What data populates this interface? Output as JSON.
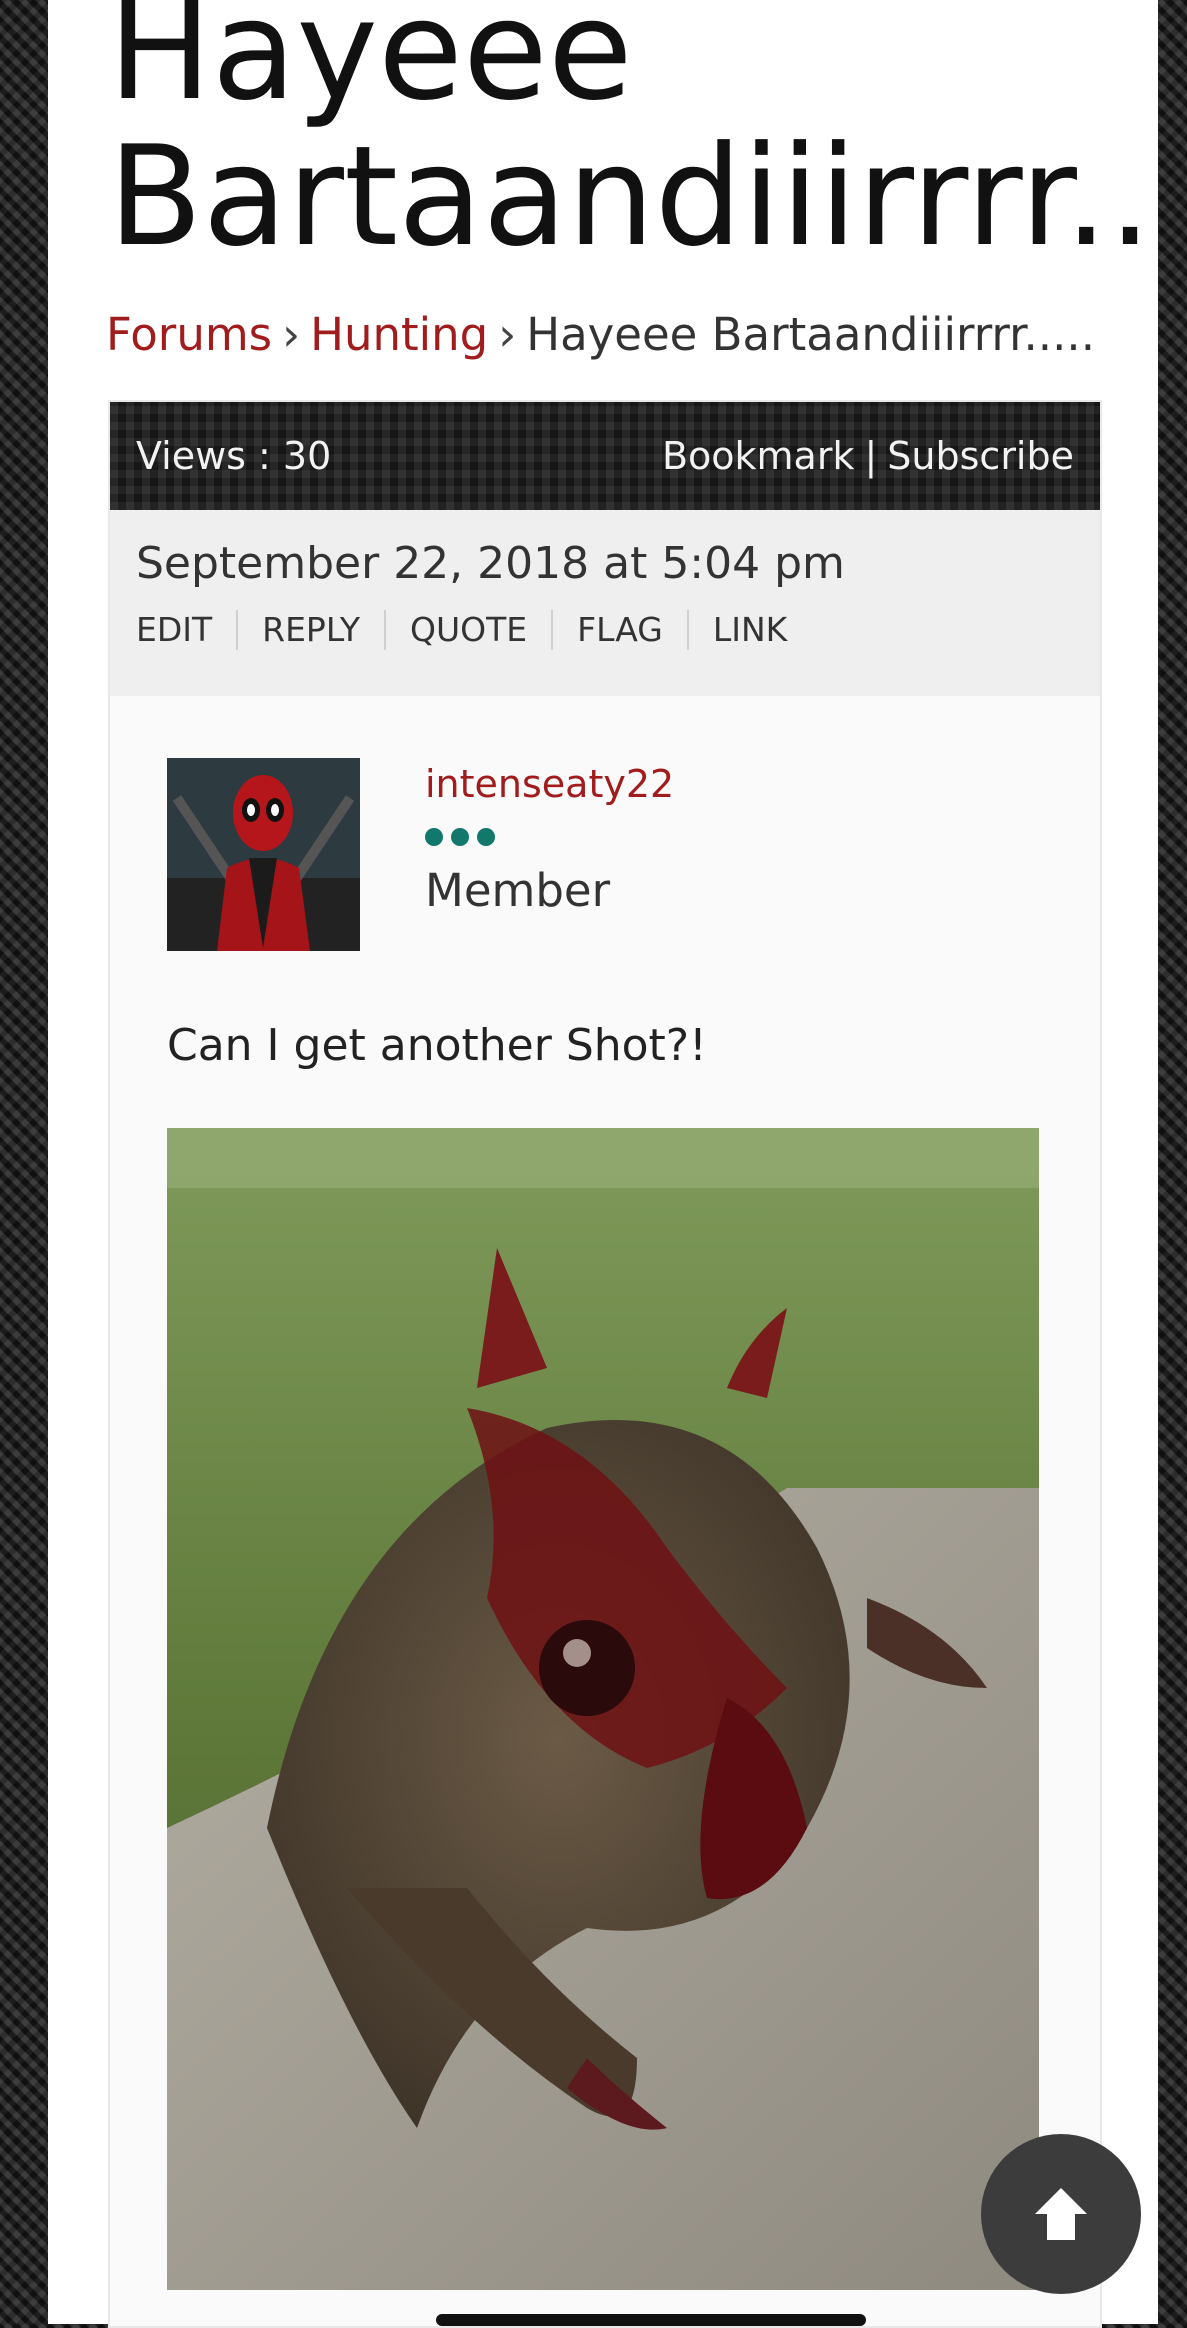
{
  "topic": {
    "title_line1": "Hayeee",
    "title_line2": "Bartaandiiirrrr....."
  },
  "breadcrumb": {
    "items": [
      "Forums",
      "Hunting"
    ],
    "separator": "›",
    "current": "Hayeee Bartaandiiirrrr....."
  },
  "topbar": {
    "views": "Views : 30",
    "bookmark": "Bookmark",
    "divider": "|",
    "subscribe": "Subscribe"
  },
  "post": {
    "date": "September 22, 2018 at 5:04 pm",
    "actions": [
      "EDIT",
      "REPLY",
      "QUOTE",
      "FLAG",
      "LINK"
    ],
    "author": {
      "username": "intenseaty22",
      "role": "Member",
      "rank_dots": 3,
      "rank_color": "#11786b"
    },
    "text": "Can I get another Shot?!"
  },
  "colors": {
    "link": "#a11d1d",
    "accent": "#11786b"
  },
  "icons": {
    "scroll_top": "arrow-up-icon"
  }
}
